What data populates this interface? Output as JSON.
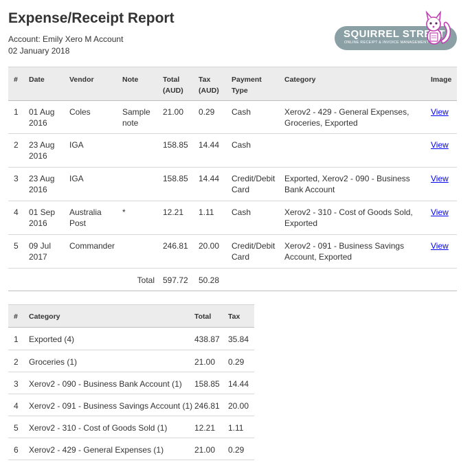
{
  "report": {
    "title": "Expense/Receipt Report",
    "account": "Account: Emily Xero M Account",
    "date": "02 January 2018"
  },
  "logo": {
    "name": "SQUIRREL STREET",
    "tagline": "ONLINE RECEIPT & INVOICE MANAGEMENT",
    "icon": "squirrel-mascot"
  },
  "receipts": {
    "headers": {
      "num": "#",
      "date": "Date",
      "vendor": "Vendor",
      "note": "Note",
      "total1": "Total",
      "total2": "(AUD)",
      "tax1": "Tax",
      "tax2": "(AUD)",
      "payment1": "Payment",
      "payment2": "Type",
      "category": "Category",
      "image": "Image"
    },
    "rows": [
      {
        "num": "1",
        "date1": "01 Aug",
        "date2": "2016",
        "vendor1": "Coles",
        "vendor2": "",
        "note1": "Sample",
        "note2": "note",
        "total": "21.00",
        "tax": "0.29",
        "pay1": "Cash",
        "pay2": "",
        "cat1": "Xerov2 - 429 - General Expenses,",
        "cat2": "Groceries, Exported",
        "image": "View"
      },
      {
        "num": "2",
        "date1": "23 Aug",
        "date2": "2016",
        "vendor1": "IGA",
        "vendor2": "",
        "note1": "",
        "note2": "",
        "total": "158.85",
        "tax": "14.44",
        "pay1": "Cash",
        "pay2": "",
        "cat1": "",
        "cat2": "",
        "image": "View"
      },
      {
        "num": "3",
        "date1": "23 Aug",
        "date2": "2016",
        "vendor1": "IGA",
        "vendor2": "",
        "note1": "",
        "note2": "",
        "total": "158.85",
        "tax": "14.44",
        "pay1": "Credit/Debit",
        "pay2": "Card",
        "cat1": "Exported, Xerov2 - 090 - Business",
        "cat2": "Bank Account",
        "image": "View"
      },
      {
        "num": "4",
        "date1": "01 Sep",
        "date2": "2016",
        "vendor1": "Australia",
        "vendor2": "Post",
        "note1": "*",
        "note2": "",
        "total": "12.21",
        "tax": "1.11",
        "pay1": "Cash",
        "pay2": "",
        "cat1": "Xerov2 - 310 - Cost of Goods Sold,",
        "cat2": "Exported",
        "image": "View"
      },
      {
        "num": "5",
        "date1": "09 Jul",
        "date2": "2017",
        "vendor1": "Commander",
        "vendor2": "",
        "note1": "",
        "note2": "",
        "total": "246.81",
        "tax": "20.00",
        "pay1": "Credit/Debit",
        "pay2": "Card",
        "cat1": "Xerov2 - 091 - Business Savings",
        "cat2": "Account, Exported",
        "image": "View"
      }
    ],
    "totals": {
      "label": "Total",
      "total": "597.72",
      "tax": "50.28"
    }
  },
  "categories": {
    "headers": {
      "num": "#",
      "category": "Category",
      "total": "Total",
      "tax": "Tax"
    },
    "rows": [
      {
        "num": "1",
        "category": "Exported (4)",
        "total": "438.87",
        "tax": "35.84"
      },
      {
        "num": "2",
        "category": "Groceries (1)",
        "total": "21.00",
        "tax": "0.29"
      },
      {
        "num": "3",
        "category": "Xerov2 - 090 - Business Bank Account (1)",
        "total": "158.85",
        "tax": "14.44"
      },
      {
        "num": "4",
        "category": "Xerov2 - 091 - Business Savings Account (1)",
        "total": "246.81",
        "tax": "20.00"
      },
      {
        "num": "5",
        "category": "Xerov2 - 310 - Cost of Goods Sold (1)",
        "total": "12.21",
        "tax": "1.11"
      },
      {
        "num": "6",
        "category": "Xerov2 - 429 - General Expenses (1)",
        "total": "21.00",
        "tax": "0.29"
      }
    ]
  },
  "colors": {
    "header_bg": "#ececec",
    "logo_bg": "#8aa0a5",
    "link": "#0000ee",
    "mascot_accent": "#c03fb0"
  }
}
